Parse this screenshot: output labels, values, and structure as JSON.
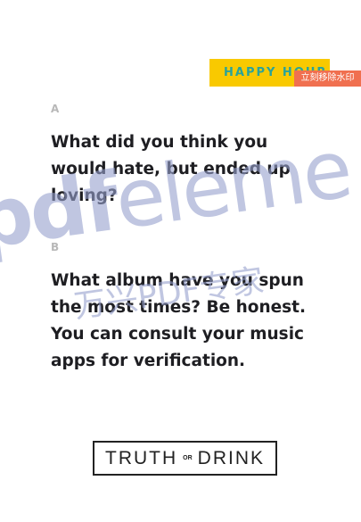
{
  "tag": "HAPPY HOUR",
  "badge": "立刻移除水印",
  "question_a": {
    "label": "A",
    "text": "What did you think you would hate, but ended up loving?"
  },
  "question_b": {
    "label": "B",
    "text": "What album have you spun the most times? Be honest. You can consult your music apps for verification."
  },
  "watermark": {
    "bold": "pdf",
    "rest": "eleme",
    "cn": "万兴PDF专家"
  },
  "logo": {
    "left": "TRUTH",
    "mid": "OR",
    "right": "DRINK"
  }
}
